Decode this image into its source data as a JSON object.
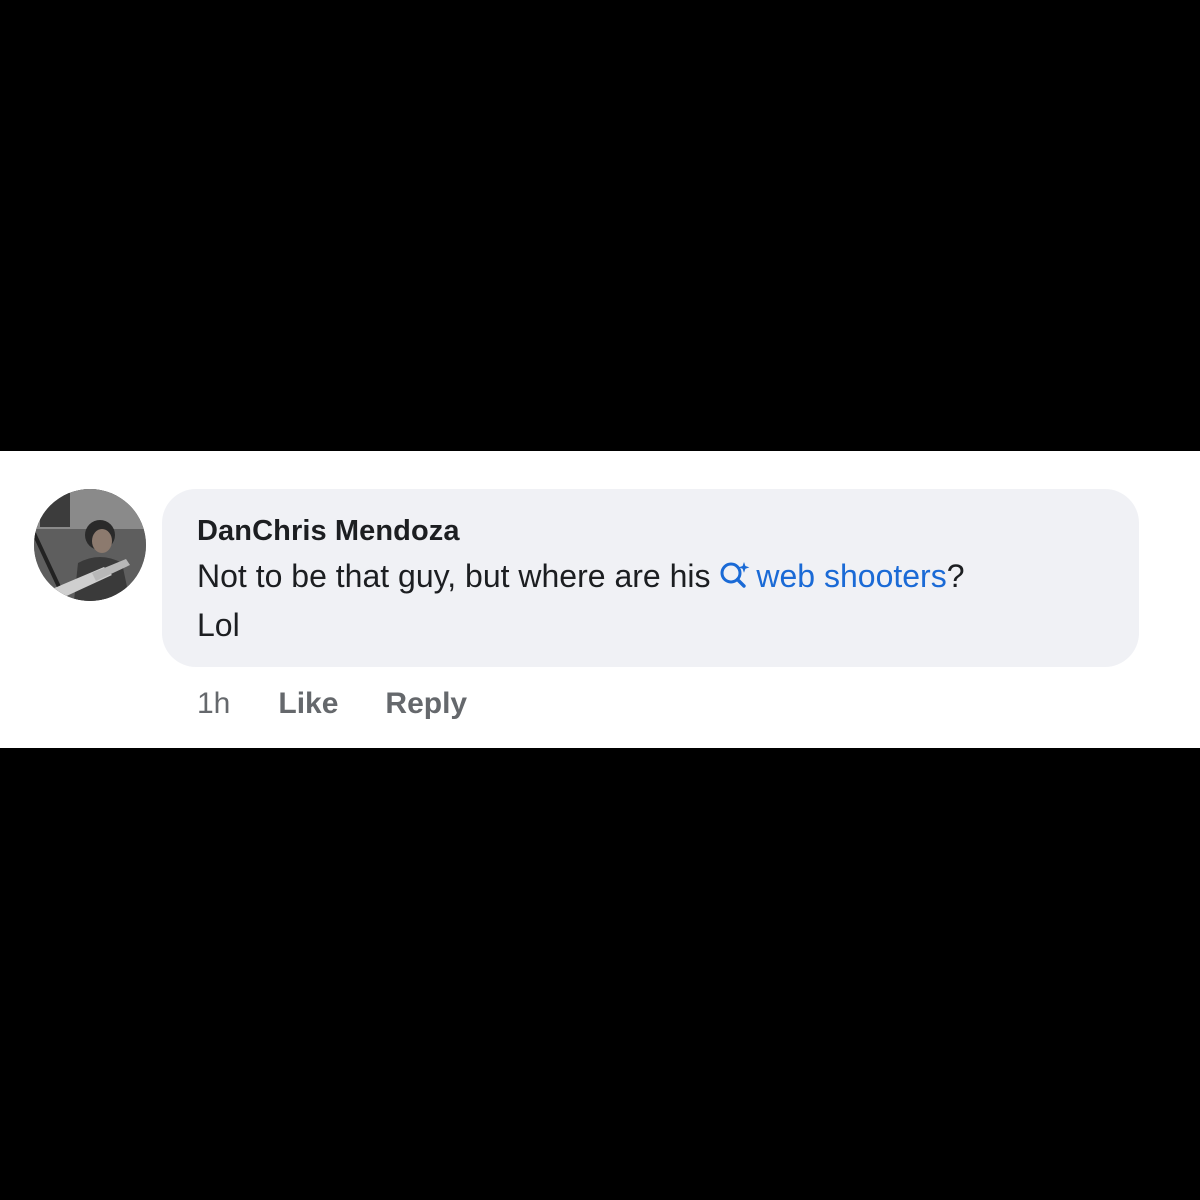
{
  "comment": {
    "author": "DanChris Mendoza",
    "text_line1_prefix": "Not to be that guy, but where are his ",
    "search_term": "web shooters",
    "text_line1_suffix": "?",
    "text_line2": "Lol",
    "timestamp": "1h",
    "like_label": "Like",
    "reply_label": "Reply"
  },
  "icons": {
    "avatar": "profile-photo",
    "search": "ai-search-sparkle-icon"
  },
  "colors": {
    "background_band": "#000000",
    "strip": "#ffffff",
    "bubble": "#f0f1f5",
    "text": "#1c1e21",
    "link": "#1a6ad6",
    "meta": "#65686c"
  }
}
